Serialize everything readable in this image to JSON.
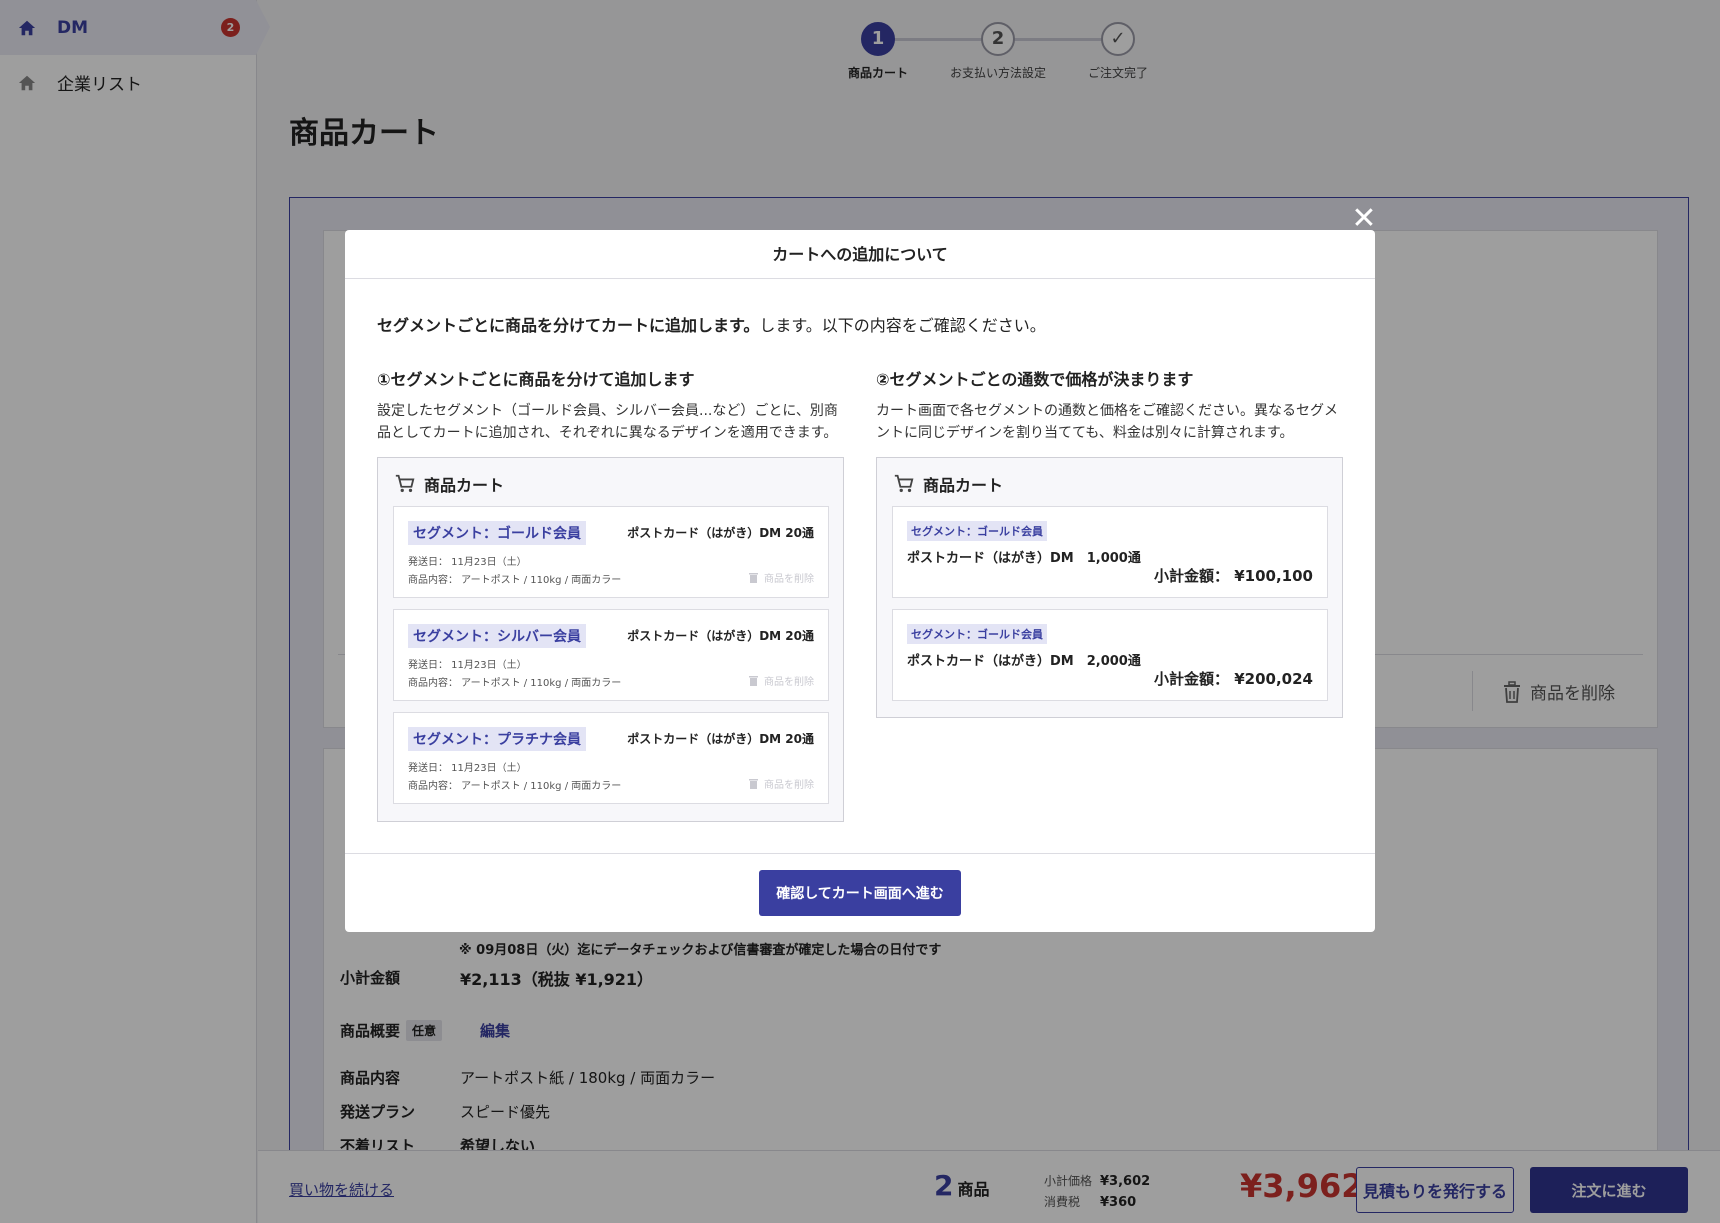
{
  "sidebar": {
    "items": [
      {
        "label": "DM",
        "badge": "2",
        "active": true
      },
      {
        "label": "企業リスト"
      }
    ]
  },
  "stepper": {
    "steps": [
      {
        "num": "1",
        "label": "商品カート"
      },
      {
        "num": "2",
        "label": "お支払い方法設定"
      },
      {
        "num": "✓",
        "label": "ご注文完了"
      }
    ]
  },
  "page": {
    "title": "商品カート"
  },
  "card1": {
    "delete_label": "商品を削除"
  },
  "card2": {
    "note": "※ 09月08日（火）迄にデータチェックおよび信書審査が確定した場合の日付です",
    "subtotal_label": "小計金額",
    "subtotal_value": "¥2,113（税抜 ¥1,921）",
    "overview_label": "商品概要",
    "optional_tag": "任意",
    "edit_link": "編集",
    "content_label": "商品内容",
    "content_value": "アートポスト紙 / 180kg / 両面カラー",
    "plan_label": "発送プラン",
    "plan_value": "スピード優先",
    "undeliv_label": "不着リスト",
    "undeliv_value": "希望しない"
  },
  "bottom": {
    "continue": "買い物を続ける",
    "count": "2",
    "count_unit": "商品",
    "subtotal_label": "小計価格",
    "subtotal": "¥3,602",
    "tax_label": "消費税",
    "tax": "¥360",
    "total": "¥3,962",
    "quote_button": "見積もりを発行する",
    "order_button": "注文に進む"
  },
  "modal": {
    "title": "カートへの追加について",
    "intro_bold": "セグメントごとに商品を分けてカートに追加します。",
    "intro_rest": "します。以下の内容をご確認ください。",
    "left": {
      "heading": "①セグメントごとに商品を分けて追加します",
      "desc": "設定したセグメント（ゴールド会員、シルバー会員...など）ごとに、別商品としてカートに追加され、それぞれに異なるデザインを適用できます。",
      "cart_title": "商品カート",
      "items": [
        {
          "segment": "セグメント：ゴールド会員",
          "product": "ポストカード（はがき）DM 20通",
          "ship": "発送日：  11月23日（土）",
          "content": "商品内容：  アートポスト / 110kg / 両面カラー",
          "delete": "商品を削除"
        },
        {
          "segment": "セグメント：シルバー会員",
          "product": "ポストカード（はがき）DM 20通",
          "ship": "発送日：  11月23日（土）",
          "content": "商品内容：  アートポスト / 110kg / 両面カラー",
          "delete": "商品を削除"
        },
        {
          "segment": "セグメント：プラチナ会員",
          "product": "ポストカード（はがき）DM 20通",
          "ship": "発送日：  11月23日（土）",
          "content": "商品内容：  アートポスト / 110kg / 両面カラー",
          "delete": "商品を削除"
        }
      ]
    },
    "right": {
      "heading": "②セグメントごとの通数で価格が決まります",
      "desc": "カート画面で各セグメントの通数と価格をご確認ください。異なるセグメントに同じデザインを割り当てても、料金は別々に計算されます。",
      "cart_title": "商品カート",
      "items": [
        {
          "segment": "セグメント：ゴールド会員",
          "product": "ポストカード（はがき）DM　1,000通",
          "subtotal": "小計金額：  ¥100,100"
        },
        {
          "segment": "セグメント：ゴールド会員",
          "product": "ポストカード（はがき）DM　2,000通",
          "subtotal": "小計金額：  ¥200,024"
        }
      ]
    },
    "confirm_button": "確認してカート画面へ進む"
  },
  "colors": {
    "accent": "#3a3fa0",
    "price_red": "#c8352f"
  }
}
